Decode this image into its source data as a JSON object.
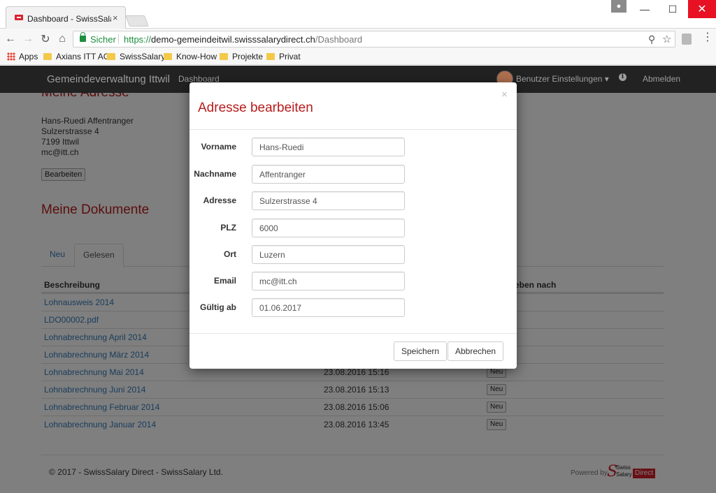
{
  "browser": {
    "tab_title": "Dashboard - SwissSalary",
    "tab_close": "×",
    "url_secure_label": "Sicher",
    "url_proto": "https://",
    "url_host": "demo-gemeindeitwil.swisssalarydirect.ch",
    "url_path": "/Dashboard",
    "bookmarks": [
      "Apps",
      "Axians ITT AG",
      "SwissSalary",
      "Know-How",
      "Projekte",
      "Privat"
    ]
  },
  "navbar": {
    "brand": "Gemeindeverwaltung Ittwil",
    "dashboard": "Dashboard",
    "user_menu": "Benutzer Einstellungen ▾",
    "info": "i",
    "logout": "Abmelden"
  },
  "address_section": {
    "title": "Meine Adresse",
    "lines": [
      "Hans-Ruedi Affentranger",
      "Sulzerstrasse 4",
      "7199 Ittwil",
      "mc@itt.ch"
    ],
    "edit_button": "Bearbeiten"
  },
  "documents": {
    "title": "Meine Dokumente",
    "tabs": [
      "Neu",
      "Gelesen"
    ],
    "headers": [
      "Beschreibung",
      "eben nach"
    ],
    "rows": [
      {
        "name": "Lohnausweis 2014",
        "date": "",
        "status": ""
      },
      {
        "name": "LDO00002.pdf",
        "date": "",
        "status": ""
      },
      {
        "name": "Lohnabrechnung April 2014",
        "date": "",
        "status": ""
      },
      {
        "name": "Lohnabrechnung März 2014",
        "date": "",
        "status": ""
      },
      {
        "name": "Lohnabrechnung Mai 2014",
        "date": "23.08.2016 15:16",
        "status": "Neu"
      },
      {
        "name": "Lohnabrechnung Juni 2014",
        "date": "23.08.2016 15:13",
        "status": "Neu"
      },
      {
        "name": "Lohnabrechnung Februar 2014",
        "date": "23.08.2016 15:06",
        "status": "Neu"
      },
      {
        "name": "Lohnabrechnung Januar 2014",
        "date": "23.08.2016 13:45",
        "status": "Neu"
      }
    ]
  },
  "footer": {
    "copyright": "© 2017 - SwissSalary Direct - SwissSalary Ltd.",
    "powered_by": "Powered by",
    "logo_swiss": "Swiss",
    "logo_salary": "Salary",
    "logo_direct": "Direct"
  },
  "modal": {
    "title": "Adresse bearbeiten",
    "close": "×",
    "fields": [
      {
        "label": "Vorname",
        "value": "Hans-Ruedi"
      },
      {
        "label": "Nachname",
        "value": "Affentranger"
      },
      {
        "label": "Adresse",
        "value": "Sulzerstrasse 4"
      },
      {
        "label": "PLZ",
        "value": "6000"
      },
      {
        "label": "Ort",
        "value": "Luzern"
      },
      {
        "label": "Email",
        "value": "mc@itt.ch"
      },
      {
        "label": "Gültig ab",
        "value": "01.06.2017"
      }
    ],
    "save_button": "Speichern",
    "cancel_button": "Abbrechen"
  }
}
